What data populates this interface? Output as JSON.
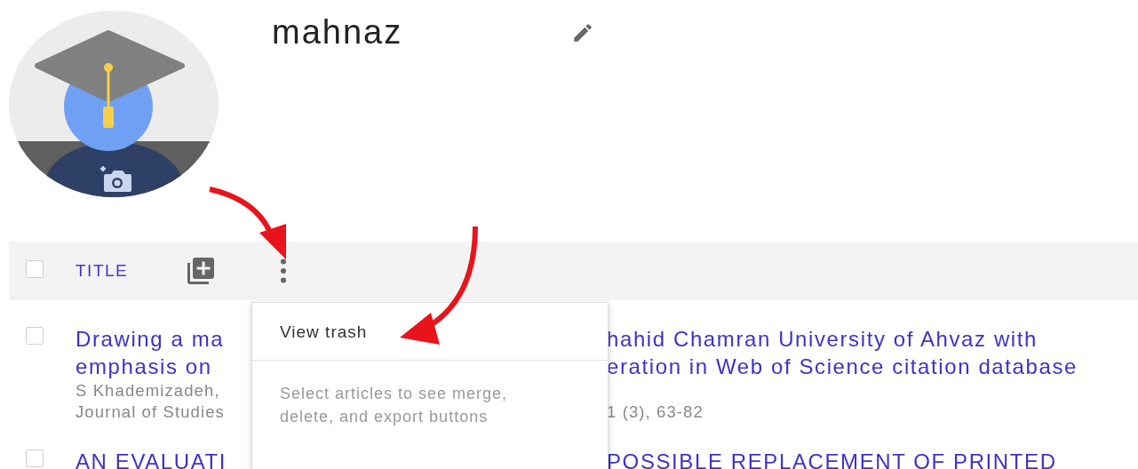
{
  "profile": {
    "name": "mahnaz"
  },
  "list_header": {
    "checked": false,
    "title_label": "TITLE"
  },
  "menu": {
    "items": [
      {
        "kind": "action",
        "label": "View trash"
      },
      {
        "kind": "hint",
        "label": "Select articles to see merge, delete, and export buttons"
      }
    ]
  },
  "articles": [
    {
      "checked": false,
      "lines": [
        {
          "kind": "title",
          "left": "Drawing a ma",
          "right": "hahid Chamran University of Ahvaz with"
        },
        {
          "kind": "title",
          "left": "emphasis on",
          "right": "eration in Web of Science citation database"
        },
        {
          "kind": "meta",
          "left": "S Khademizadeh,"
        },
        {
          "kind": "meta",
          "left": "Journal of Studies",
          "right": "1 (3), 63-82"
        }
      ]
    },
    {
      "checked": false,
      "lines": [
        {
          "kind": "title",
          "left": "AN EVALUATI",
          "right": "POSSIBLE REPLACEMENT OF PRINTED"
        }
      ]
    }
  ]
}
